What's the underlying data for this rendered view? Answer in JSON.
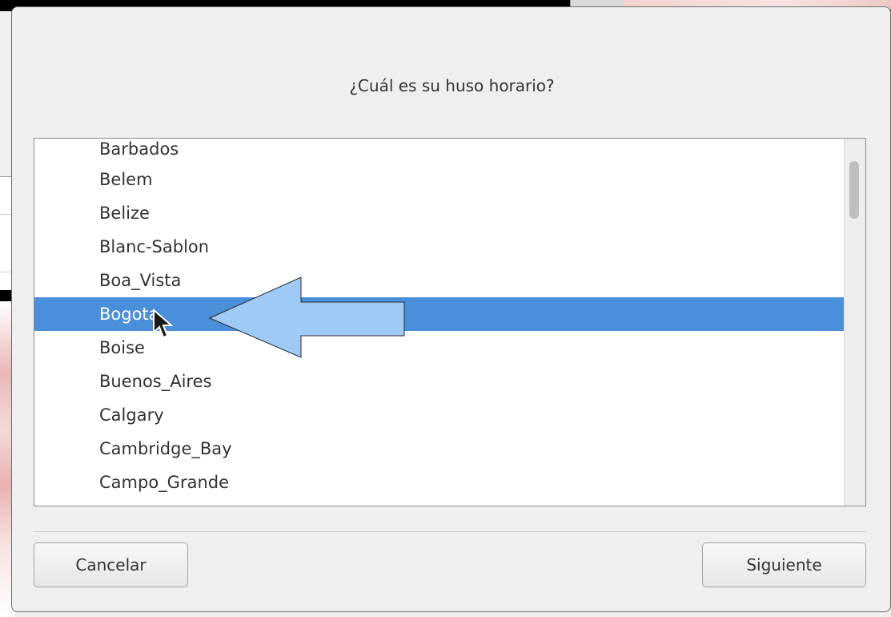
{
  "dialog": {
    "title": "¿Cuál es su huso horario?",
    "timezones": [
      "Barbados",
      "Belem",
      "Belize",
      "Blanc-Sablon",
      "Boa_Vista",
      "Bogota",
      "Boise",
      "Buenos_Aires",
      "Calgary",
      "Cambridge_Bay",
      "Campo_Grande"
    ],
    "selected_timezone": "Bogota",
    "buttons": {
      "cancel_label": "Cancelar",
      "next_label": "Siguiente"
    }
  },
  "icons": {
    "cursor": "mouse-pointer-icon",
    "annotation": "annotation-arrow-icon"
  },
  "colors": {
    "selection": "#4a8fd9",
    "annotation_arrow_fill": "#9fcaf5",
    "dialog_background": "#f0efef"
  }
}
